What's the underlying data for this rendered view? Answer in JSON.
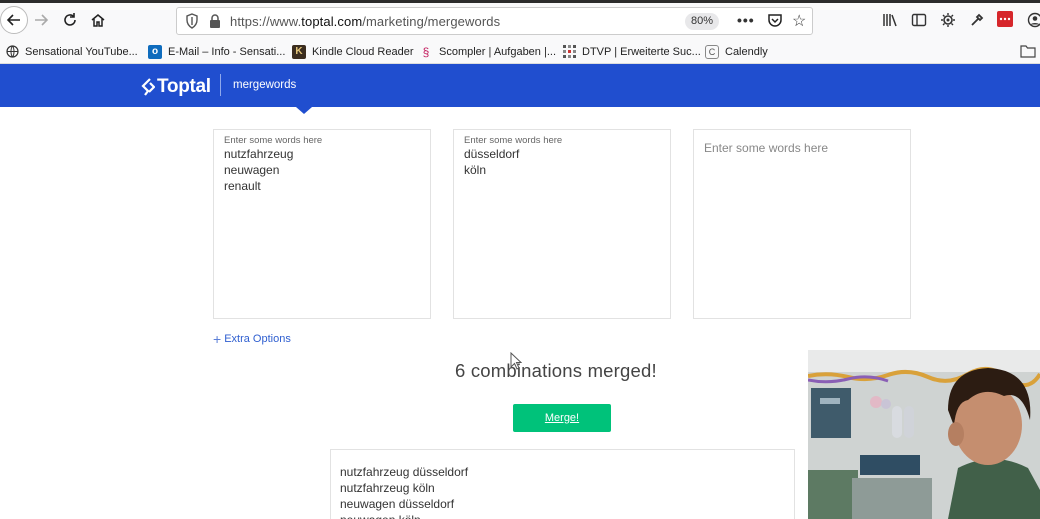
{
  "browser": {
    "url_prefix": "https://www.",
    "url_domain": "toptal.com",
    "url_path": "/marketing/mergewords",
    "zoom": "80%",
    "more_label": "•••"
  },
  "bookmarks": [
    {
      "label": "Sensational YouTube...",
      "icon": "globe-icon"
    },
    {
      "label": "E-Mail – Info - Sensati...",
      "icon": "outlook-icon"
    },
    {
      "label": "Kindle Cloud Reader",
      "icon": "kindle-icon"
    },
    {
      "label": "Scompler | Aufgaben |...",
      "icon": "scompler-icon"
    },
    {
      "label": "DTVP | Erweiterte Suc...",
      "icon": "dtvp-icon"
    },
    {
      "label": "Calendly",
      "icon": "calendly-icon"
    }
  ],
  "brand": {
    "logo": "Toptal",
    "product": "mergewords",
    "color": "#204ecf"
  },
  "inputs": [
    {
      "label": "Enter some words here",
      "text": "nutzfahrzeug\nneuwagen\nrenault"
    },
    {
      "label": "Enter some words here",
      "text": "düsseldorf\nköln"
    },
    {
      "placeholder": "Enter some words here"
    }
  ],
  "extra_options": "Extra Options",
  "result_heading": "6 combinations merged!",
  "merge_button": "Merge!",
  "merge_button_color": "#00c27a",
  "output_text": "nutzfahrzeug düsseldorf\nnutzfahrzeug köln\nneuwagen düsseldorf\nneuwagen köln"
}
